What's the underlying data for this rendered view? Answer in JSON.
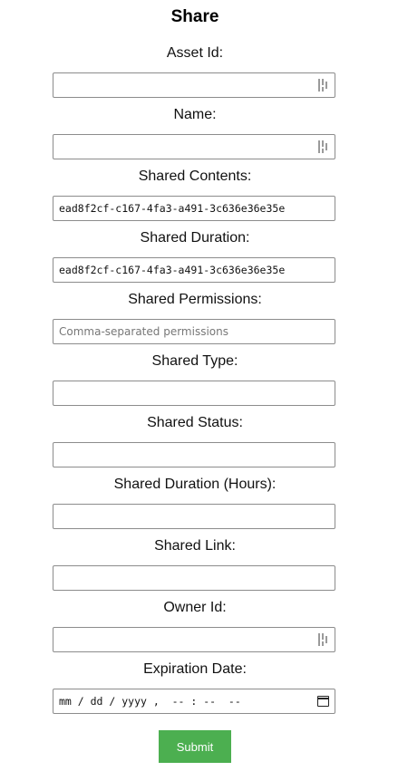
{
  "form": {
    "title": "Share",
    "submit_label": "Submit",
    "fields": {
      "asset_id": {
        "label": "Asset Id:",
        "value": ""
      },
      "name": {
        "label": "Name:",
        "value": ""
      },
      "shared_contents": {
        "label": "Shared Contents:",
        "value": "ead8f2cf-c167-4fa3-a491-3c636e36e35e"
      },
      "shared_duration": {
        "label": "Shared Duration:",
        "value": "ead8f2cf-c167-4fa3-a491-3c636e36e35e"
      },
      "shared_permissions": {
        "label": "Shared Permissions:",
        "value": "",
        "placeholder": "Comma-separated permissions"
      },
      "shared_type": {
        "label": "Shared Type:",
        "value": ""
      },
      "shared_status": {
        "label": "Shared Status:",
        "value": ""
      },
      "shared_duration_hours": {
        "label": "Shared Duration (Hours):",
        "value": ""
      },
      "shared_link": {
        "label": "Shared Link:",
        "value": ""
      },
      "owner_id": {
        "label": "Owner Id:",
        "value": ""
      },
      "expiration_date": {
        "label": "Expiration Date:",
        "placeholder": "mm / dd / yyyy ,  -- : --  --"
      }
    }
  },
  "icons": {
    "password_manager": "password-manager-icon",
    "calendar": "calendar-icon"
  },
  "colors": {
    "submit_bg": "#4caf50",
    "input_border": "#8c8c8c"
  }
}
